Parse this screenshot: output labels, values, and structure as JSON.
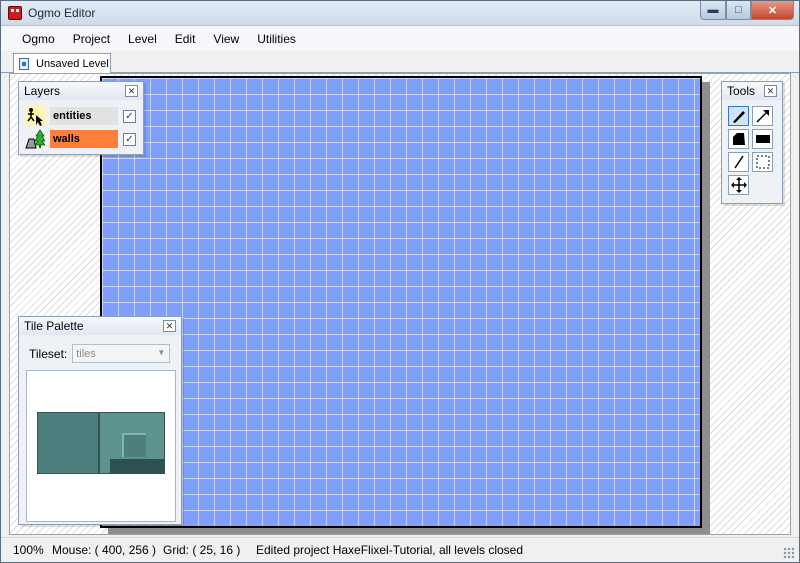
{
  "window": {
    "title": "Ogmo Editor"
  },
  "menu": [
    "Ogmo",
    "Project",
    "Level",
    "Edit",
    "View",
    "Utilities"
  ],
  "tabs": [
    {
      "label": "Unsaved Level",
      "icon": "document-icon"
    }
  ],
  "layers_panel": {
    "title": "Layers",
    "items": [
      {
        "name": "entities",
        "icon": "entity-cursor-icon",
        "visible": true,
        "selected": false
      },
      {
        "name": "walls",
        "icon": "tree-grid-icon",
        "visible": true,
        "selected": true
      }
    ]
  },
  "tools_panel": {
    "title": "Tools",
    "tools": [
      "pencil-icon",
      "arrow-icon",
      "flood-fill-icon",
      "rectangle-icon",
      "line-icon",
      "select-icon",
      "move-icon"
    ]
  },
  "tile_palette": {
    "title": "Tile Palette",
    "tileset_label": "Tileset:",
    "tileset_value": "tiles"
  },
  "status": {
    "zoom": "100%",
    "mouse": "Mouse: ( 400, 256 )",
    "grid": "Grid: ( 25, 16 )",
    "message": "Edited project HaxeFlixel-Tutorial, all levels closed"
  },
  "colors": {
    "canvas": "#809efc",
    "selected_layer": "#ff7e3a",
    "tiles": "#4b7e7c"
  }
}
